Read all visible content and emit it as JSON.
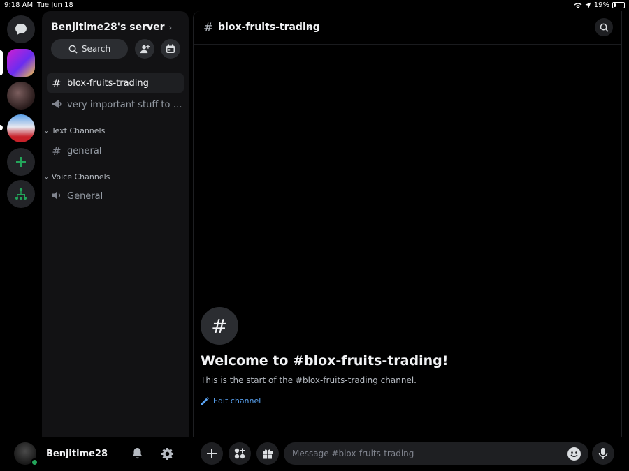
{
  "status_bar": {
    "time": "9:18 AM",
    "date": "Tue Jun 18",
    "battery": "19%"
  },
  "rail": {
    "items": [
      "direct-messages",
      "server-1",
      "server-2",
      "server-3",
      "add-server",
      "discover"
    ]
  },
  "server": {
    "name": "Benjitime28's server",
    "search_label": "Search"
  },
  "channels": {
    "pinned": [
      {
        "name": "blox-fruits-trading",
        "type": "text",
        "active": true
      },
      {
        "name": "very important stuff to ta...",
        "type": "announcement",
        "active": false
      }
    ],
    "categories": [
      {
        "label": "Text Channels",
        "channels": [
          {
            "name": "general",
            "type": "text"
          }
        ]
      },
      {
        "label": "Voice Channels",
        "channels": [
          {
            "name": "General",
            "type": "voice"
          }
        ]
      }
    ]
  },
  "user": {
    "name": "Benjitime28",
    "status": "online"
  },
  "chat": {
    "channel": "blox-fruits-trading",
    "welcome_title": "Welcome to #blox-fruits-trading!",
    "welcome_subtitle": "This is the start of the #blox-fruits-trading channel.",
    "edit_channel": "Edit channel"
  },
  "composer": {
    "placeholder": "Message #blox-fruits-trading"
  },
  "colors": {
    "online": "#23a55a",
    "link": "#5ba5f5",
    "add_server_green": "#23a55a"
  }
}
